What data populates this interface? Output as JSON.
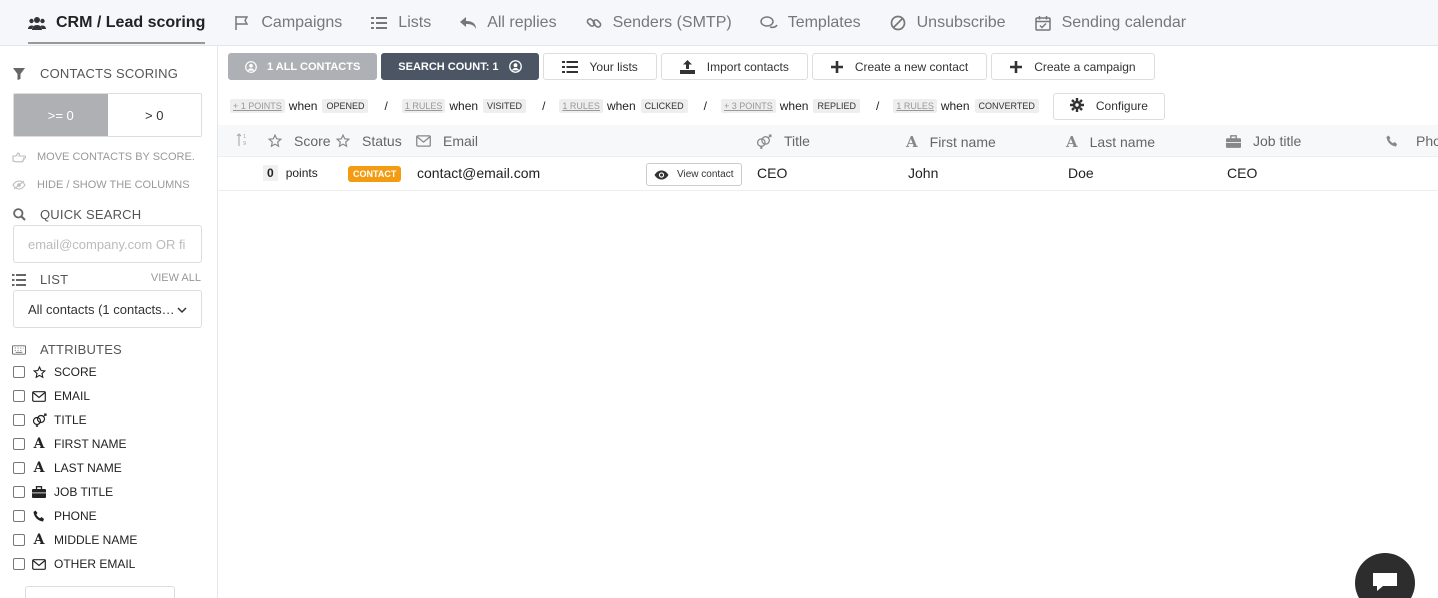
{
  "nav": {
    "items": [
      {
        "label": "CRM / Lead scoring",
        "icon": "users-icon",
        "active": true
      },
      {
        "label": "Campaigns",
        "icon": "flag-icon"
      },
      {
        "label": "Lists",
        "icon": "list-icon"
      },
      {
        "label": "All replies",
        "icon": "reply-icon"
      },
      {
        "label": "Senders (SMTP)",
        "icon": "link-icon"
      },
      {
        "label": "Templates",
        "icon": "comments-icon"
      },
      {
        "label": "Unsubscribe",
        "icon": "ban-icon"
      },
      {
        "label": "Sending calendar",
        "icon": "calendar-icon"
      }
    ]
  },
  "sidebar": {
    "contacts_scoring": "CONTACTS SCORING",
    "seg_on": ">= 0",
    "seg_off": "> 0",
    "move_contacts": "MOVE CONTACTS BY SCORE.",
    "hide_show": "HIDE / SHOW THE COLUMNS",
    "quick_search": "QUICK SEARCH",
    "search_placeholder": "email@company.com OR fi",
    "list_heading": "LIST",
    "view_all": "VIEW ALL",
    "list_selected": "All contacts (1 contacts in total)",
    "attributes_heading": "ATTRIBUTES",
    "attributes": [
      {
        "label": "SCORE",
        "icon": "star-icon"
      },
      {
        "label": "EMAIL",
        "icon": "envelope-icon"
      },
      {
        "label": "TITLE",
        "icon": "gender-icon"
      },
      {
        "label": "FIRST NAME",
        "icon": "font-icon"
      },
      {
        "label": "LAST NAME",
        "icon": "font-icon"
      },
      {
        "label": "JOB TITLE",
        "icon": "briefcase-icon"
      },
      {
        "label": "PHONE",
        "icon": "phone-icon"
      },
      {
        "label": "MIDDLE NAME",
        "icon": "font-icon"
      },
      {
        "label": "OTHER EMAIL",
        "icon": "envelope-icon"
      }
    ]
  },
  "toolbar": {
    "all_contacts": "1 ALL CONTACTS",
    "search_count": "SEARCH COUNT: 1",
    "your_lists": "Your lists",
    "import_contacts": "Import contacts",
    "create_contact": "Create a new contact",
    "create_campaign": "Create a campaign"
  },
  "rules": {
    "items": [
      {
        "points": "+ 1 POINTS",
        "when": "when",
        "event": "OPENED"
      },
      {
        "points": "1 RULES",
        "when": "when",
        "event": "VISITED"
      },
      {
        "points": "1 RULES",
        "when": "when",
        "event": "CLICKED"
      },
      {
        "points": "+ 3 POINTS",
        "when": "when",
        "event": "REPLIED"
      },
      {
        "points": "1 RULES",
        "when": "when",
        "event": "CONVERTED"
      }
    ],
    "separator": "/",
    "configure": "Configure"
  },
  "table": {
    "headers": {
      "score": "Score",
      "status": "Status",
      "email": "Email",
      "title": "Title",
      "first_name": "First name",
      "last_name": "Last name",
      "job_title": "Job title",
      "phone": "Pho"
    },
    "row": {
      "score": "0",
      "points_label": "points",
      "status": "CONTACT",
      "email": "contact@email.com",
      "view_contact": "View contact",
      "title": "CEO",
      "first_name": "John",
      "last_name": "Doe",
      "job_title": "CEO"
    }
  },
  "colors": {
    "status_badge": "#f39c12",
    "search_count_bg": "#4b5563",
    "all_contacts_bg": "#adb0b4"
  }
}
